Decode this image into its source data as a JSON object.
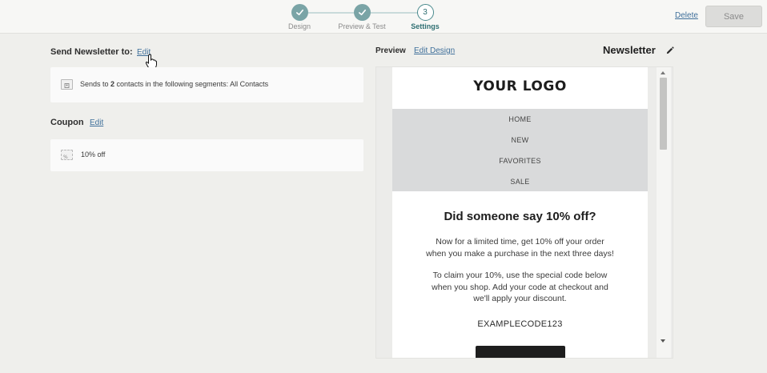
{
  "header": {
    "steps": [
      {
        "label": "Design",
        "state": "done"
      },
      {
        "label": "Preview & Test",
        "state": "done"
      },
      {
        "label": "Settings",
        "state": "current",
        "number": "3"
      }
    ],
    "delete_label": "Delete",
    "save_label": "Save"
  },
  "send": {
    "title": "Send Newsletter to:",
    "edit_label": "Edit",
    "summary_prefix": "Sends to ",
    "summary_count": "2",
    "summary_suffix": " contacts in the following segments: All Contacts",
    "icon": "contacts-icon"
  },
  "coupon": {
    "title": "Coupon",
    "edit_label": "Edit",
    "value": "10% off",
    "icon": "coupon-icon"
  },
  "preview": {
    "label": "Preview",
    "edit_design_label": "Edit Design",
    "newsletter_title": "Newsletter",
    "email": {
      "logo": "YOUR LOGO",
      "nav": [
        "HOME",
        "NEW",
        "FAVORITES",
        "SALE"
      ],
      "headline": "Did someone say 10% off?",
      "paragraph1_line1": "Now for a limited time, get 10% off your order",
      "paragraph1_line2": "when you make a purchase in the next three days!",
      "paragraph2_line1": "To claim your 10%, use the special code below",
      "paragraph2_line2": "when you shop. Add your code at checkout and",
      "paragraph2_line3": "we'll apply your discount.",
      "code": "EXAMPLECODE123"
    }
  },
  "colors": {
    "accent": "#2f6f72",
    "step_done": "#7aa4a6",
    "link": "#3f6f9a",
    "background": "#efefec",
    "nav_band": "#d9dadb"
  }
}
